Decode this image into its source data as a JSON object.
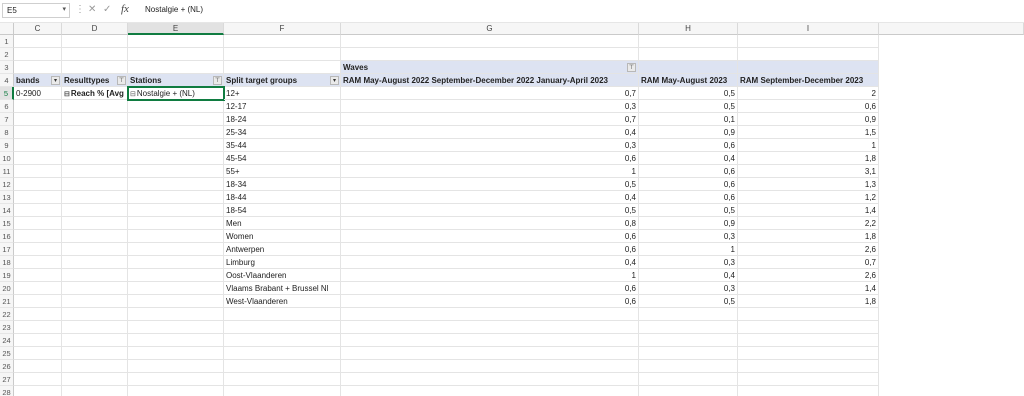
{
  "formula_bar": {
    "name_box": "E5",
    "formula": "Nostalgie + (NL)",
    "icons": [
      "more-icon",
      "cancel-icon",
      "enter-icon",
      "function-icon"
    ]
  },
  "columns": [
    "C",
    "D",
    "E",
    "F",
    "G",
    "H",
    "I"
  ],
  "selected_column": "E",
  "row_numbers": [
    "1",
    "2",
    "3",
    "4",
    "5",
    "6",
    "7",
    "8",
    "9",
    "10",
    "11",
    "12",
    "13",
    "14",
    "15",
    "16",
    "17",
    "18",
    "19",
    "20",
    "21",
    "22",
    "23",
    "24",
    "25",
    "26",
    "27",
    "28"
  ],
  "pivot": {
    "waves_label": "Waves",
    "header": {
      "c": "bands",
      "d": "Resulttypes",
      "e": "Stations",
      "f": "Split target groups",
      "g": "RAM May-August 2022 September-December 2022 January-April 2023",
      "h": "RAM May-August 2023",
      "i": "RAM September-December 2023"
    },
    "row5": {
      "c": "0-2900",
      "d": "Reach % [Avg",
      "e": "Nostalgie + (NL)"
    },
    "rows": [
      {
        "group": "12+",
        "g": "0,7",
        "h": "0,5",
        "i": "2"
      },
      {
        "group": "12-17",
        "g": "0,3",
        "h": "0,5",
        "i": "0,6"
      },
      {
        "group": "18-24",
        "g": "0,7",
        "h": "0,1",
        "i": "0,9"
      },
      {
        "group": "25-34",
        "g": "0,4",
        "h": "0,9",
        "i": "1,5"
      },
      {
        "group": "35-44",
        "g": "0,3",
        "h": "0,6",
        "i": "1"
      },
      {
        "group": "45-54",
        "g": "0,6",
        "h": "0,4",
        "i": "1,8"
      },
      {
        "group": "55+",
        "g": "1",
        "h": "0,6",
        "i": "3,1"
      },
      {
        "group": "18-34",
        "g": "0,5",
        "h": "0,6",
        "i": "1,3"
      },
      {
        "group": "18-44",
        "g": "0,4",
        "h": "0,6",
        "i": "1,2"
      },
      {
        "group": "18-54",
        "g": "0,5",
        "h": "0,5",
        "i": "1,4"
      },
      {
        "group": "Men",
        "g": "0,8",
        "h": "0,9",
        "i": "2,2"
      },
      {
        "group": "Women",
        "g": "0,6",
        "h": "0,3",
        "i": "1,8"
      },
      {
        "group": "Antwerpen",
        "g": "0,6",
        "h": "1",
        "i": "2,6"
      },
      {
        "group": "Limburg",
        "g": "0,4",
        "h": "0,3",
        "i": "0,7"
      },
      {
        "group": "Oost-Vlaanderen",
        "g": "1",
        "h": "0,4",
        "i": "2,6"
      },
      {
        "group": "Vlaams Brabant + Brussel Nl",
        "g": "0,6",
        "h": "0,3",
        "i": "1,4"
      },
      {
        "group": "West-Vlaanderen",
        "g": "0,6",
        "h": "0,5",
        "i": "1,8"
      }
    ]
  },
  "colors": {
    "header_fill": "#dde3f2",
    "accent": "#107c41"
  }
}
